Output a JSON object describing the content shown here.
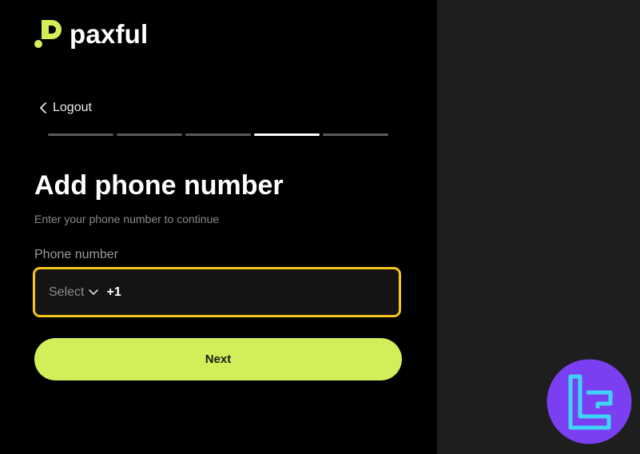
{
  "brand": {
    "name": "paxful",
    "accent_color": "#d2ee58"
  },
  "nav": {
    "logout_label": "Logout"
  },
  "progress": {
    "total_steps": 5,
    "current_step": 4
  },
  "form": {
    "title": "Add phone number",
    "subtitle": "Enter your phone number to continue",
    "phone_label": "Phone number",
    "country_select": {
      "value": "Select"
    },
    "dial_code": "+1",
    "phone_value": "",
    "focus_color": "#f5c518",
    "next_label": "Next"
  },
  "icons": {
    "logo": "paxful-logo-icon",
    "back": "chevron-left-icon",
    "dropdown": "chevron-down-icon",
    "watermark": "tradingfinder-logo-icon"
  }
}
